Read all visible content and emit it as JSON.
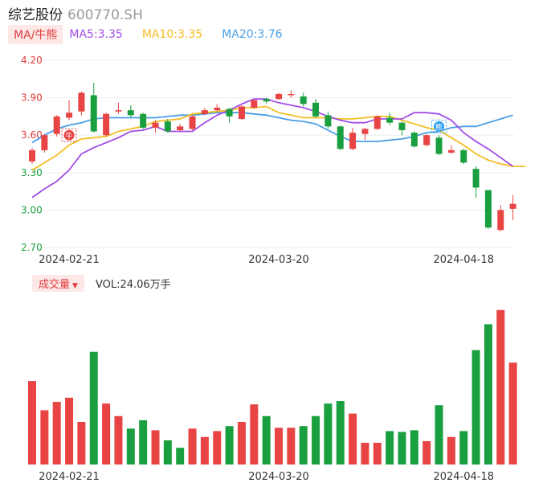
{
  "header": {
    "name": "综艺股份",
    "code": "600770.SH"
  },
  "ma_legend": {
    "toggle_label": "MA/牛熊",
    "items": [
      {
        "label": "MA5:3.35",
        "color": "#a24ee6"
      },
      {
        "label": "MA10:3.35",
        "color": "#f4bd21"
      },
      {
        "label": "MA20:3.76",
        "color": "#4a9ee6"
      }
    ]
  },
  "volume_legend": {
    "toggle_label": "成交量",
    "caret": "▼",
    "value_label": "VOL:24.06万手"
  },
  "markers": [
    {
      "label": "牛",
      "color": "#e84444",
      "x": 3,
      "y": 3.6
    },
    {
      "label": "熊",
      "color": "#2d9ff5",
      "x": 33,
      "y": 3.67
    }
  ],
  "colors": {
    "up": "#e84444",
    "down": "#1a9f40",
    "grid": "#eeeeee",
    "price_axis_up": "#e23b3b",
    "price_axis_down": "#1a9f40"
  },
  "chart_data": [
    {
      "type": "candlestick",
      "x_tick_labels": [
        {
          "index": 3,
          "label": "2024-02-21"
        },
        {
          "index": 20,
          "label": "2024-03-20"
        },
        {
          "index": 35,
          "label": "2024-04-18"
        }
      ],
      "y_ticks": [
        4.2,
        3.9,
        3.6,
        3.3,
        3.0,
        2.7
      ],
      "y_tick_labels": [
        "4.20",
        "3.90",
        "3.60",
        "3.30",
        "3.00",
        "2.70"
      ],
      "ylim": [
        2.7,
        4.2
      ],
      "grid": true,
      "candles": [
        {
          "o": 3.39,
          "c": 3.48,
          "h": 3.5,
          "l": 3.37
        },
        {
          "o": 3.48,
          "c": 3.6,
          "h": 3.61,
          "l": 3.46
        },
        {
          "o": 3.61,
          "c": 3.75,
          "h": 3.76,
          "l": 3.59
        },
        {
          "o": 3.74,
          "c": 3.78,
          "h": 3.88,
          "l": 3.72
        },
        {
          "o": 3.79,
          "c": 3.94,
          "h": 3.95,
          "l": 3.76
        },
        {
          "o": 3.92,
          "c": 3.63,
          "h": 4.02,
          "l": 3.62
        },
        {
          "o": 3.6,
          "c": 3.77,
          "h": 3.78,
          "l": 3.59
        },
        {
          "o": 3.79,
          "c": 3.8,
          "h": 3.86,
          "l": 3.77
        },
        {
          "o": 3.8,
          "c": 3.76,
          "h": 3.84,
          "l": 3.74
        },
        {
          "o": 3.77,
          "c": 3.66,
          "h": 3.78,
          "l": 3.65
        },
        {
          "o": 3.66,
          "c": 3.7,
          "h": 3.72,
          "l": 3.62
        },
        {
          "o": 3.71,
          "c": 3.63,
          "h": 3.73,
          "l": 3.62
        },
        {
          "o": 3.64,
          "c": 3.67,
          "h": 3.69,
          "l": 3.63
        },
        {
          "o": 3.65,
          "c": 3.75,
          "h": 3.76,
          "l": 3.64
        },
        {
          "o": 3.77,
          "c": 3.8,
          "h": 3.82,
          "l": 3.76
        },
        {
          "o": 3.8,
          "c": 3.82,
          "h": 3.85,
          "l": 3.79
        },
        {
          "o": 3.81,
          "c": 3.75,
          "h": 3.82,
          "l": 3.7
        },
        {
          "o": 3.73,
          "c": 3.83,
          "h": 3.84,
          "l": 3.72
        },
        {
          "o": 3.82,
          "c": 3.88,
          "h": 3.89,
          "l": 3.81
        },
        {
          "o": 3.89,
          "c": 3.87,
          "h": 3.9,
          "l": 3.85
        },
        {
          "o": 3.89,
          "c": 3.93,
          "h": 3.94,
          "l": 3.88
        },
        {
          "o": 3.93,
          "c": 3.93,
          "h": 3.96,
          "l": 3.9
        },
        {
          "o": 3.91,
          "c": 3.85,
          "h": 3.94,
          "l": 3.83
        },
        {
          "o": 3.86,
          "c": 3.75,
          "h": 3.89,
          "l": 3.74
        },
        {
          "o": 3.76,
          "c": 3.67,
          "h": 3.79,
          "l": 3.65
        },
        {
          "o": 3.67,
          "c": 3.49,
          "h": 3.68,
          "l": 3.48
        },
        {
          "o": 3.49,
          "c": 3.62,
          "h": 3.66,
          "l": 3.48
        },
        {
          "o": 3.61,
          "c": 3.65,
          "h": 3.66,
          "l": 3.56
        },
        {
          "o": 3.65,
          "c": 3.75,
          "h": 3.76,
          "l": 3.64
        },
        {
          "o": 3.74,
          "c": 3.7,
          "h": 3.78,
          "l": 3.68
        },
        {
          "o": 3.7,
          "c": 3.64,
          "h": 3.71,
          "l": 3.6
        },
        {
          "o": 3.62,
          "c": 3.51,
          "h": 3.63,
          "l": 3.5
        },
        {
          "o": 3.52,
          "c": 3.6,
          "h": 3.61,
          "l": 3.51
        },
        {
          "o": 3.58,
          "c": 3.45,
          "h": 3.6,
          "l": 3.44
        },
        {
          "o": 3.46,
          "c": 3.48,
          "h": 3.52,
          "l": 3.45
        },
        {
          "o": 3.48,
          "c": 3.38,
          "h": 3.49,
          "l": 3.37
        },
        {
          "o": 3.33,
          "c": 3.18,
          "h": 3.35,
          "l": 3.1
        },
        {
          "o": 3.16,
          "c": 2.86,
          "h": 3.16,
          "l": 2.85
        },
        {
          "o": 2.84,
          "c": 3.0,
          "h": 3.04,
          "l": 2.83
        },
        {
          "o": 3.01,
          "c": 3.05,
          "h": 3.12,
          "l": 2.92
        }
      ],
      "ma5": [
        3.1,
        3.17,
        3.23,
        3.32,
        3.45,
        3.5,
        3.54,
        3.58,
        3.63,
        3.64,
        3.67,
        3.63,
        3.63,
        3.63,
        3.7,
        3.76,
        3.8,
        3.85,
        3.89,
        3.89,
        3.86,
        3.84,
        3.82,
        3.79,
        3.75,
        3.72,
        3.7,
        3.7,
        3.73,
        3.73,
        3.73,
        3.78,
        3.78,
        3.77,
        3.72,
        3.62,
        3.55,
        3.49,
        3.42,
        3.35
      ],
      "ma10": [
        3.32,
        3.38,
        3.44,
        3.52,
        3.57,
        3.58,
        3.59,
        3.63,
        3.65,
        3.67,
        3.71,
        3.72,
        3.73,
        3.77,
        3.78,
        3.79,
        3.8,
        3.82,
        3.82,
        3.83,
        3.78,
        3.76,
        3.74,
        3.74,
        3.74,
        3.73,
        3.73,
        3.74,
        3.75,
        3.75,
        3.72,
        3.69,
        3.66,
        3.64,
        3.58,
        3.52,
        3.45,
        3.4,
        3.37,
        3.35,
        3.35
      ],
      "ma20": [
        3.54,
        3.6,
        3.65,
        3.68,
        3.7,
        3.73,
        3.74,
        3.74,
        3.74,
        3.74,
        3.74,
        3.75,
        3.76,
        3.76,
        3.77,
        3.78,
        3.78,
        3.78,
        3.77,
        3.76,
        3.74,
        3.72,
        3.71,
        3.69,
        3.64,
        3.59,
        3.55,
        3.55,
        3.55,
        3.56,
        3.57,
        3.59,
        3.62,
        3.63,
        3.66,
        3.67,
        3.67,
        3.7,
        3.73,
        3.76
      ]
    },
    {
      "type": "bar",
      "title": "成交量",
      "values": [
        1.0,
        0.65,
        0.75,
        0.8,
        0.51,
        1.35,
        0.73,
        0.58,
        0.43,
        0.53,
        0.41,
        0.29,
        0.2,
        0.43,
        0.33,
        0.4,
        0.46,
        0.51,
        0.72,
        0.58,
        0.44,
        0.44,
        0.46,
        0.58,
        0.73,
        0.76,
        0.61,
        0.26,
        0.26,
        0.4,
        0.39,
        0.41,
        0.28,
        0.71,
        0.33,
        0.4,
        1.37,
        1.68,
        1.85,
        1.22
      ],
      "up": [
        true,
        true,
        true,
        true,
        true,
        false,
        true,
        true,
        false,
        false,
        true,
        false,
        false,
        true,
        true,
        true,
        false,
        true,
        true,
        false,
        true,
        true,
        false,
        false,
        false,
        false,
        true,
        true,
        true,
        false,
        false,
        false,
        true,
        false,
        true,
        false,
        false,
        false,
        true,
        true
      ],
      "x_tick_labels": [
        {
          "index": 3,
          "label": "2024-02-21"
        },
        {
          "index": 20,
          "label": "2024-03-20"
        },
        {
          "index": 35,
          "label": "2024-04-18"
        }
      ]
    }
  ]
}
